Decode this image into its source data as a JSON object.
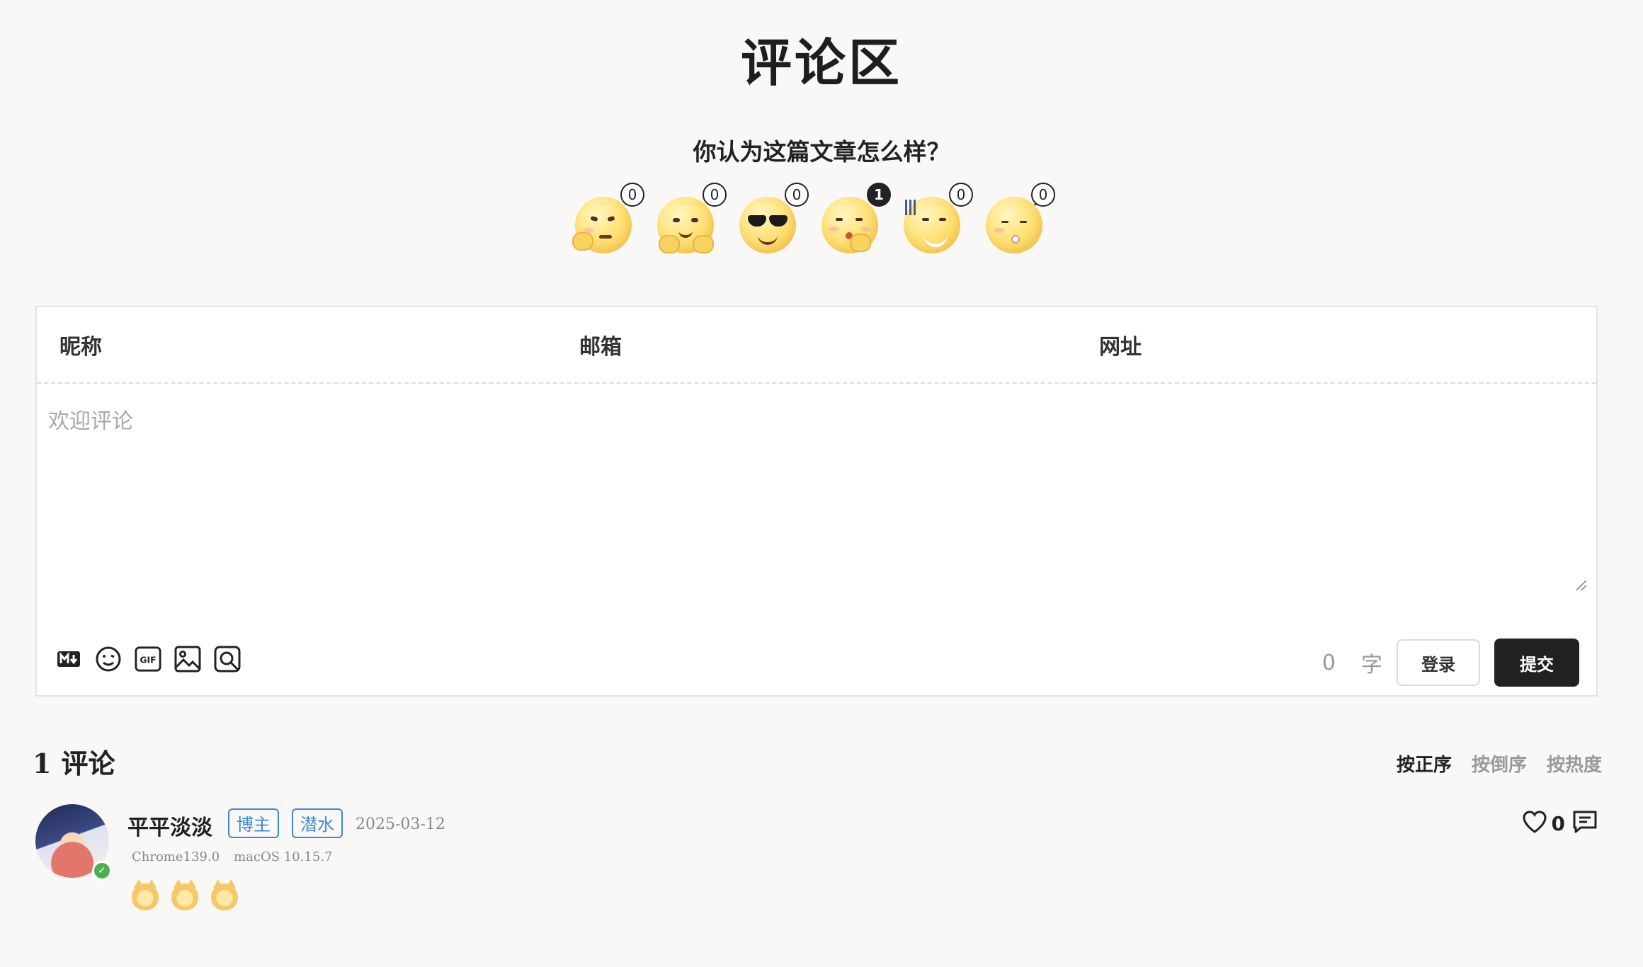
{
  "header": {
    "title": "评论区",
    "question": "你认为这篇文章怎么样？"
  },
  "reactions": [
    {
      "name": "thinking-face",
      "count": "0",
      "active": false
    },
    {
      "name": "hugging-face",
      "count": "0",
      "active": false
    },
    {
      "name": "sunglasses-face",
      "count": "0",
      "active": false
    },
    {
      "name": "shy-face",
      "count": "1",
      "active": true
    },
    {
      "name": "speechless-face",
      "count": "0",
      "active": false
    },
    {
      "name": "sleepy-face",
      "count": "0",
      "active": false
    }
  ],
  "form": {
    "nick_label": "昵称",
    "mail_label": "邮箱",
    "link_label": "网址",
    "comment_placeholder": "欢迎评论",
    "char_count": "0",
    "char_unit": "字",
    "login_label": "登录",
    "submit_label": "提交",
    "tools": [
      "markdown-icon",
      "emoji-icon",
      "gif-icon",
      "image-icon",
      "preview-icon"
    ]
  },
  "comments_section": {
    "count": "1",
    "label": "评论",
    "sort_options": [
      "按正序",
      "按倒序",
      "按热度"
    ],
    "active_sort": "按正序"
  },
  "comment": {
    "author": "平平淡淡",
    "tags": [
      "博主",
      "潜水"
    ],
    "date": "2025-03-12",
    "browser": "Chrome139.0",
    "os": "macOS 10.15.7",
    "likes": "0",
    "accent": "#3a8ad8"
  }
}
